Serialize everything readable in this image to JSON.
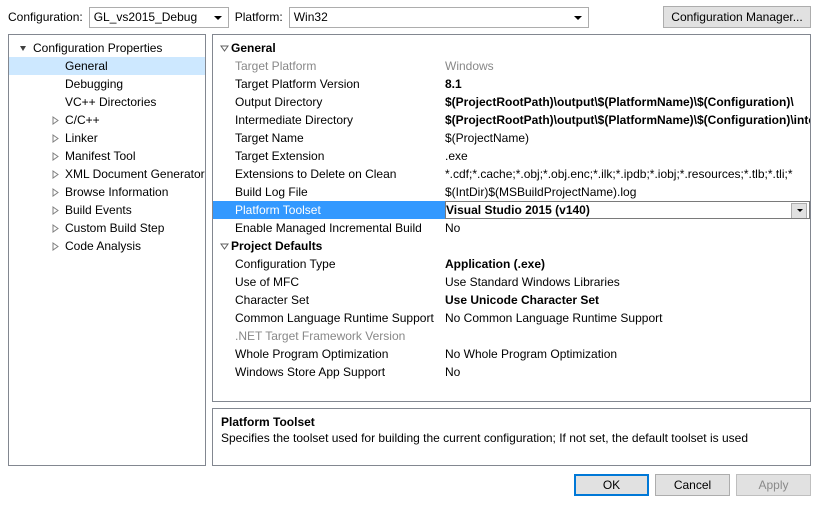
{
  "toolbar": {
    "config_label": "Configuration:",
    "config_value": "GL_vs2015_Debug",
    "platform_label": "Platform:",
    "platform_value": "Win32",
    "manager_btn": "Configuration Manager..."
  },
  "tree": {
    "root": "Configuration Properties",
    "items": [
      {
        "label": "General",
        "selected": true,
        "depth": 2,
        "expandable": false
      },
      {
        "label": "Debugging",
        "depth": 2,
        "expandable": false
      },
      {
        "label": "VC++ Directories",
        "depth": 2,
        "expandable": false
      },
      {
        "label": "C/C++",
        "depth": 2,
        "expandable": true
      },
      {
        "label": "Linker",
        "depth": 2,
        "expandable": true
      },
      {
        "label": "Manifest Tool",
        "depth": 2,
        "expandable": true
      },
      {
        "label": "XML Document Generator",
        "depth": 2,
        "expandable": true
      },
      {
        "label": "Browse Information",
        "depth": 2,
        "expandable": true
      },
      {
        "label": "Build Events",
        "depth": 2,
        "expandable": true
      },
      {
        "label": "Custom Build Step",
        "depth": 2,
        "expandable": true
      },
      {
        "label": "Code Analysis",
        "depth": 2,
        "expandable": true
      }
    ]
  },
  "grid": {
    "groups": [
      {
        "header": "General",
        "rows": [
          {
            "name": "Target Platform",
            "value": "Windows",
            "dim": true
          },
          {
            "name": "Target Platform Version",
            "value": "8.1",
            "bold": true
          },
          {
            "name": "Output Directory",
            "value": "$(ProjectRootPath)\\output\\$(PlatformName)\\$(Configuration)\\",
            "bold": true
          },
          {
            "name": "Intermediate Directory",
            "value": "$(ProjectRootPath)\\output\\$(PlatformName)\\$(Configuration)\\intermediate\\",
            "bold": true
          },
          {
            "name": "Target Name",
            "value": "$(ProjectName)"
          },
          {
            "name": "Target Extension",
            "value": ".exe"
          },
          {
            "name": "Extensions to Delete on Clean",
            "value": "*.cdf;*.cache;*.obj;*.obj.enc;*.ilk;*.ipdb;*.iobj;*.resources;*.tlb;*.tli;*"
          },
          {
            "name": "Build Log File",
            "value": "$(IntDir)$(MSBuildProjectName).log"
          },
          {
            "name": "Platform Toolset",
            "value": "Visual Studio 2015 (v140)",
            "selected": true
          },
          {
            "name": "Enable Managed Incremental Build",
            "value": "No"
          }
        ]
      },
      {
        "header": "Project Defaults",
        "rows": [
          {
            "name": "Configuration Type",
            "value": "Application (.exe)",
            "bold": true
          },
          {
            "name": "Use of MFC",
            "value": "Use Standard Windows Libraries"
          },
          {
            "name": "Character Set",
            "value": "Use Unicode Character Set",
            "bold": true
          },
          {
            "name": "Common Language Runtime Support",
            "value": "No Common Language Runtime Support"
          },
          {
            "name": ".NET Target Framework Version",
            "value": "",
            "dim": true
          },
          {
            "name": "Whole Program Optimization",
            "value": "No Whole Program Optimization"
          },
          {
            "name": "Windows Store App Support",
            "value": "No"
          }
        ]
      }
    ]
  },
  "description": {
    "title": "Platform Toolset",
    "text": "Specifies the toolset used for building the current configuration; If not set, the default toolset is used"
  },
  "footer": {
    "ok": "OK",
    "cancel": "Cancel",
    "apply": "Apply"
  }
}
